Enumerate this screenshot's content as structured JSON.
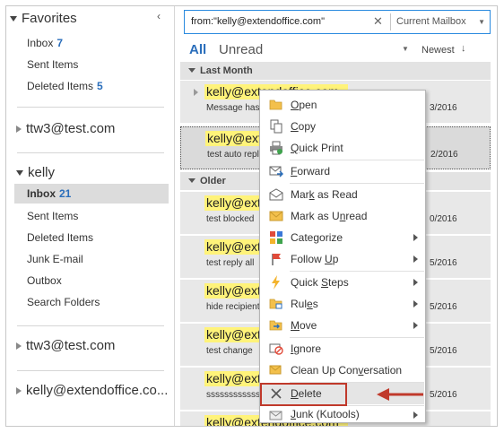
{
  "sidebar": {
    "favorites_label": "Favorites",
    "collapse_glyph": "‹",
    "favorites": [
      {
        "label": "Inbox",
        "count": "7"
      },
      {
        "label": "Sent Items",
        "count": ""
      },
      {
        "label": "Deleted Items",
        "count": "5"
      }
    ],
    "accounts": [
      "ttw3@test.com",
      "kelly",
      "ttw3@test.com",
      "kelly@extendoffice.co..."
    ],
    "kelly_folders": [
      {
        "label": "Inbox",
        "count": "21"
      },
      {
        "label": "Sent Items",
        "count": ""
      },
      {
        "label": "Deleted Items",
        "count": ""
      },
      {
        "label": "Junk E-mail",
        "count": ""
      },
      {
        "label": "Outbox",
        "count": ""
      },
      {
        "label": "Search Folders",
        "count": ""
      }
    ]
  },
  "search": {
    "query": "from:\"kelly@extendoffice.com\"",
    "clear_glyph": "✕",
    "scope": "Current Mailbox"
  },
  "list_header": {
    "all": "All",
    "unread": "Unread",
    "sort": "Newest",
    "sort_arrow": "↓"
  },
  "groups": [
    "Last Month",
    "Older"
  ],
  "mails": [
    {
      "from": "kelly@extendoffice.com",
      "subject": "Message has been",
      "date": "3/2016"
    },
    {
      "from": "kelly@extendoffice.com",
      "subject": "test auto reply",
      "date": "2/2016"
    },
    {
      "from": "kelly@extendoffice.com",
      "subject": "test blocked",
      "date": "0/2016"
    },
    {
      "from": "kelly@extendoffice.com",
      "subject": "test reply all",
      "date": "5/2016"
    },
    {
      "from": "kelly@extendoffice.com",
      "subject": "hide recipients",
      "date": "5/2016"
    },
    {
      "from": "kelly@extendoffice.com",
      "subject": "test change",
      "date": "5/2016"
    },
    {
      "from": "kelly@extendoffice.com",
      "subject": "ssssssssssssss",
      "date": "5/2016"
    },
    {
      "from": "kelly@extendoffice.com",
      "subject": "",
      "date": ""
    }
  ],
  "context_menu": [
    {
      "pre": "",
      "u": "O",
      "post": "pen",
      "icon": "open-folder-icon",
      "sub": false
    },
    {
      "pre": "",
      "u": "C",
      "post": "opy",
      "icon": "copy-icon",
      "sub": false
    },
    {
      "pre": "",
      "u": "Q",
      "post": "uick Print",
      "icon": "printer-icon",
      "sub": false
    },
    {
      "pre": "",
      "u": "F",
      "post": "orward",
      "icon": "forward-icon",
      "sub": false
    },
    {
      "pre": "Mar",
      "u": "k",
      "post": " as Read",
      "icon": "envelope-open-icon",
      "sub": false
    },
    {
      "pre": "Mark as U",
      "u": "n",
      "post": "read",
      "icon": "envelope-icon",
      "sub": false
    },
    {
      "pre": "Cate",
      "u": "g",
      "post": "orize",
      "icon": "categories-icon",
      "sub": true
    },
    {
      "pre": "Follow ",
      "u": "U",
      "post": "p",
      "icon": "flag-icon",
      "sub": true
    },
    {
      "pre": "Quick ",
      "u": "S",
      "post": "teps",
      "icon": "lightning-icon",
      "sub": true
    },
    {
      "pre": "Rul",
      "u": "e",
      "post": "s",
      "icon": "rules-icon",
      "sub": true
    },
    {
      "pre": "",
      "u": "M",
      "post": "ove",
      "icon": "move-icon",
      "sub": true
    },
    {
      "pre": "",
      "u": "I",
      "post": "gnore",
      "icon": "ignore-icon",
      "sub": false
    },
    {
      "pre": "Clean Up Con",
      "u": "v",
      "post": "ersation",
      "icon": "cleanup-icon",
      "sub": false
    },
    {
      "pre": "",
      "u": "D",
      "post": "elete",
      "icon": "delete-x-icon",
      "sub": false
    },
    {
      "pre": "",
      "u": "J",
      "post": "unk (Kutools)",
      "icon": "junk-icon",
      "sub": true
    }
  ],
  "colors": {
    "accent": "#2a6ebb",
    "highlight": "#fff37a",
    "callout": "#c0392b"
  }
}
